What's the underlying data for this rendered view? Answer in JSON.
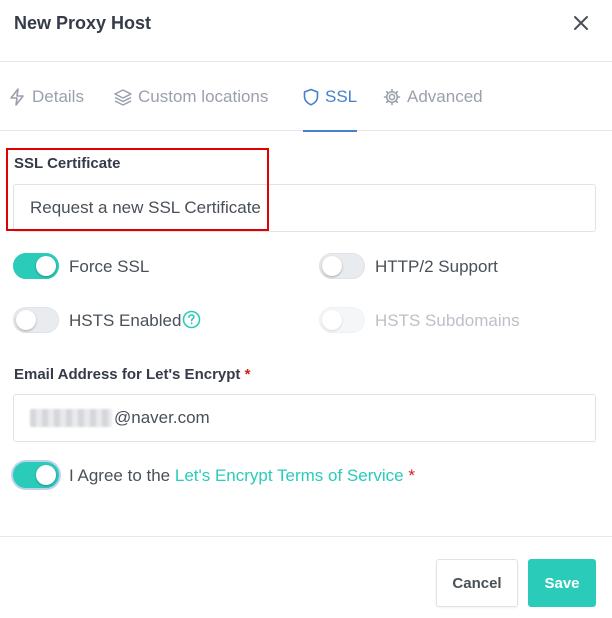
{
  "modal": {
    "title": "New Proxy Host",
    "close_icon": "close-icon"
  },
  "tabs": [
    {
      "label": "Details",
      "icon": "bolt-icon",
      "active": false
    },
    {
      "label": "Custom locations",
      "icon": "layers-icon",
      "active": false
    },
    {
      "label": "SSL",
      "icon": "shield-icon",
      "active": true
    },
    {
      "label": "Advanced",
      "icon": "gear-icon",
      "active": false
    }
  ],
  "ssl": {
    "certificate_label": "SSL Certificate",
    "certificate_value": "Request a new SSL Certificate",
    "force_ssl": {
      "label": "Force SSL",
      "on": true
    },
    "http2": {
      "label": "HTTP/2 Support",
      "on": false
    },
    "hsts": {
      "label": "HSTS Enabled",
      "on": false
    },
    "hsts_sub": {
      "label": "HSTS Subdomains",
      "on": false,
      "disabled": true
    },
    "email_label": "Email Address for Let's Encrypt",
    "required_mark": "*",
    "email_visible_suffix": "@naver.com",
    "agree_prefix": "I Agree to the ",
    "agree_link": "Let's Encrypt Terms of Service",
    "agree_on": true
  },
  "footer": {
    "cancel_label": "Cancel",
    "save_label": "Save"
  },
  "colors": {
    "accent": "#2bcbba",
    "tab_active": "#467fcf",
    "required": "#cd201f",
    "highlight": "#e00000"
  }
}
